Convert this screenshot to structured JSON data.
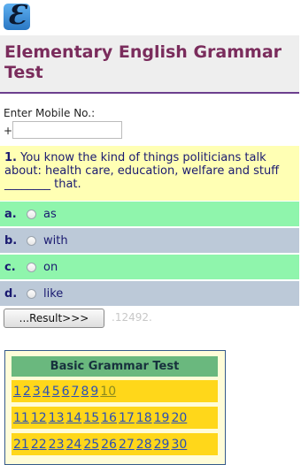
{
  "app": {
    "logo_letter": "Ɛ",
    "title": "Elementary English Grammar Test"
  },
  "mobile": {
    "label": "Enter Mobile No.:",
    "prefix": "+",
    "value": ""
  },
  "question": {
    "number": "1.",
    "text": "You know the kind of things politicians talk about: health care, education, welfare and stuff ________ that."
  },
  "options": [
    {
      "letter": "a.",
      "label": "as"
    },
    {
      "letter": "b.",
      "label": "with"
    },
    {
      "letter": "c.",
      "label": "on"
    },
    {
      "letter": "d.",
      "label": "like"
    }
  ],
  "result": {
    "button_label": "...Result>>>",
    "score": ".12492."
  },
  "grammar_box": {
    "heading": "Basic Grammar Test",
    "rows": [
      [
        "1",
        "2",
        "3",
        "4",
        "5",
        "6",
        "7",
        "8",
        "9",
        "10"
      ],
      [
        "11",
        "12",
        "13",
        "14",
        "15",
        "16",
        "17",
        "18",
        "19",
        "20"
      ],
      [
        "21",
        "22",
        "23",
        "24",
        "25",
        "26",
        "27",
        "28",
        "29",
        "30"
      ]
    ]
  },
  "colors": {
    "title": "#7a2c5c",
    "accent_line": "#6c3f8e",
    "option_green": "#8ff5ac",
    "option_gray": "#bcc9d8"
  }
}
